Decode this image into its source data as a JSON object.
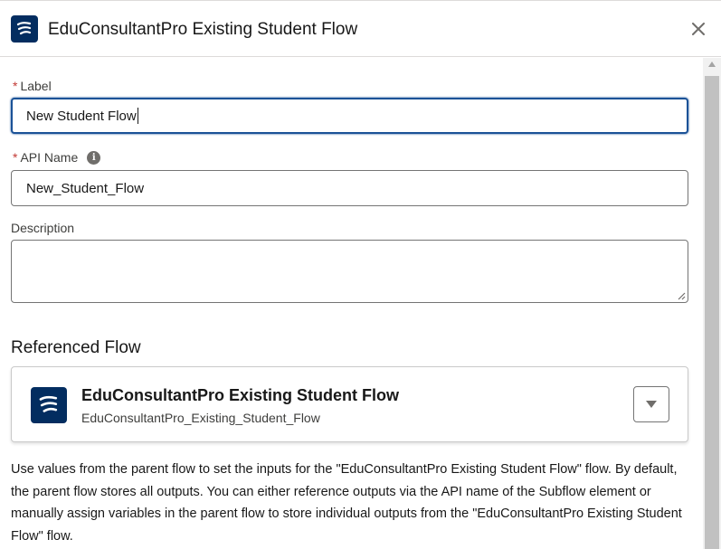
{
  "header": {
    "title": "EduConsultantPro Existing Student Flow",
    "icon": "flow-icon",
    "close_icon": "close-icon"
  },
  "form": {
    "label_field": {
      "label": "Label",
      "required_mark": "*",
      "value": "New Student Flow"
    },
    "api_name_field": {
      "label": "API Name",
      "required_mark": "*",
      "value": "New_Student_Flow",
      "info_icon": "info-icon",
      "info_glyph": "i"
    },
    "description_field": {
      "label": "Description",
      "value": ""
    }
  },
  "referenced_flow": {
    "section_title": "Referenced Flow",
    "title": "EduConsultantPro Existing Student Flow",
    "api_name": "EduConsultantPro_Existing_Student_Flow",
    "dropdown_icon": "chevron-down-icon"
  },
  "help_text": "Use values from the parent flow to set the inputs for the \"EduConsultantPro Existing Student Flow\" flow. By default, the parent flow stores all outputs. You can either reference outputs via the API name of the Subflow element or manually assign variables in the parent flow to store individual outputs from the \"EduConsultantPro Existing Student Flow\" flow.",
  "colors": {
    "brand_icon_bg": "#032d60",
    "focus_border": "#1b5297",
    "required": "#c23934",
    "text": "#181818"
  }
}
